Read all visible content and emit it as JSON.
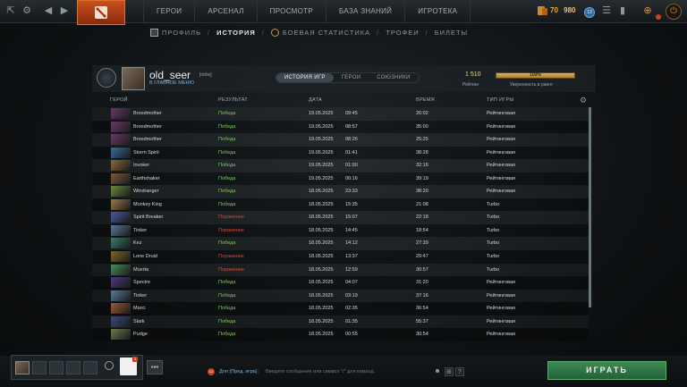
{
  "topbar": {
    "nav": [
      "ГЕРОИ",
      "АРСЕНАЛ",
      "ПРОСМОТР",
      "БАЗА ЗНАНИЙ",
      "ИГРОТЕКА"
    ],
    "gold": "70",
    "shards": "980",
    "level": "13"
  },
  "subnav": {
    "items": [
      "ПРОФИЛЬ",
      "ИСТОРИЯ",
      "БОЕВАЯ СТАТИСТИКА",
      "ТРОФЕИ",
      "БИЛЕТЫ"
    ],
    "active": "ИСТОРИЯ"
  },
  "profile": {
    "username": "old_seer",
    "tag": "[nbbs]",
    "back": "В ГЛАВНОЕ МЕНЮ",
    "tabs": [
      "ИСТОРИЯ ИГР",
      "ГЕРОИ",
      "СОЮЗНИКИ"
    ],
    "rating_value": "1 510",
    "rating_label": "Рейтинг",
    "confidence_value": "100%",
    "confidence_fraction": 1.0,
    "confidence_label": "Уверенность в ранге"
  },
  "table": {
    "headers": [
      "ГЕРОЙ",
      "РЕЗУЛЬТАТ",
      "ДАТА",
      "ВРЕМЯ",
      "ТИП ИГРЫ"
    ],
    "rows": [
      {
        "hero": "Broodmother",
        "result": "Победа",
        "win": true,
        "date": "19.05.2025",
        "time": "09:45",
        "duration": "26:02",
        "type": "Рейтинговая",
        "color": "#6a3a6a"
      },
      {
        "hero": "Broodmother",
        "result": "Победа",
        "win": true,
        "date": "19.05.2025",
        "time": "08:57",
        "duration": "35:00",
        "type": "Рейтинговая",
        "color": "#6a3a6a"
      },
      {
        "hero": "Broodmother",
        "result": "Победа",
        "win": true,
        "date": "19.05.2025",
        "time": "08:26",
        "duration": "25:25",
        "type": "Рейтинговая",
        "color": "#6a3a6a"
      },
      {
        "hero": "Storm Spirit",
        "result": "Победа",
        "win": true,
        "date": "19.05.2025",
        "time": "01:41",
        "duration": "38:28",
        "type": "Рейтинговая",
        "color": "#3a6aa0"
      },
      {
        "hero": "Invoker",
        "result": "Победа",
        "win": true,
        "date": "19.05.2025",
        "time": "01:00",
        "duration": "32:16",
        "type": "Рейтинговая",
        "color": "#8a6a3a"
      },
      {
        "hero": "Earthshaker",
        "result": "Победа",
        "win": true,
        "date": "19.05.2025",
        "time": "00:16",
        "duration": "39:19",
        "type": "Рейтинговая",
        "color": "#7a5a3a"
      },
      {
        "hero": "Windranger",
        "result": "Победа",
        "win": true,
        "date": "18.05.2025",
        "time": "23:33",
        "duration": "38:20",
        "type": "Рейтинговая",
        "color": "#6a8a3a"
      },
      {
        "hero": "Monkey King",
        "result": "Победа",
        "win": true,
        "date": "18.05.2025",
        "time": "15:35",
        "duration": "21:08",
        "type": "Turbo",
        "color": "#9a7a4a"
      },
      {
        "hero": "Spirit Breaker",
        "result": "Поражение",
        "win": false,
        "date": "18.05.2025",
        "time": "15:07",
        "duration": "22:18",
        "type": "Turbo",
        "color": "#4a5aa0"
      },
      {
        "hero": "Tinker",
        "result": "Поражение",
        "win": false,
        "date": "18.05.2025",
        "time": "14:45",
        "duration": "18:54",
        "type": "Turbo",
        "color": "#5a7a9a"
      },
      {
        "hero": "Kez",
        "result": "Победа",
        "win": true,
        "date": "18.05.2025",
        "time": "14:12",
        "duration": "27:39",
        "type": "Turbo",
        "color": "#3a7a6a"
      },
      {
        "hero": "Lone Druid",
        "result": "Поражение",
        "win": false,
        "date": "18.05.2025",
        "time": "13:37",
        "duration": "29:47",
        "type": "Turbo",
        "color": "#7a6a2a"
      },
      {
        "hero": "Muerta",
        "result": "Поражение",
        "win": false,
        "date": "18.05.2025",
        "time": "12:59",
        "duration": "30:57",
        "type": "Turbo",
        "color": "#4a8a5a"
      },
      {
        "hero": "Spectre",
        "result": "Победа",
        "win": true,
        "date": "18.05.2025",
        "time": "04:07",
        "duration": "31:20",
        "type": "Рейтинговая",
        "color": "#4a3a7a"
      },
      {
        "hero": "Tinker",
        "result": "Победа",
        "win": true,
        "date": "18.05.2025",
        "time": "03:19",
        "duration": "37:16",
        "type": "Рейтинговая",
        "color": "#5a7a9a"
      },
      {
        "hero": "Marci",
        "result": "Победа",
        "win": true,
        "date": "18.05.2025",
        "time": "02:35",
        "duration": "36:54",
        "type": "Рейтинговая",
        "color": "#9a5a3a"
      },
      {
        "hero": "Slark",
        "result": "Победа",
        "win": true,
        "date": "18.05.2025",
        "time": "01:35",
        "duration": "55:37",
        "type": "Рейтинговая",
        "color": "#3a4a7a"
      },
      {
        "hero": "Pudge",
        "result": "Победа",
        "win": true,
        "date": "18.05.2025",
        "time": "00:55",
        "duration": "30:54",
        "type": "Рейтинговая",
        "color": "#6a7a4a"
      }
    ]
  },
  "chat": {
    "badge": "13",
    "target": "Для (Пред. игра):",
    "placeholder": "Введите сообщение или символ \"/\" для команд."
  },
  "party": {
    "badge": "3"
  },
  "play_label": "ИГРАТЬ",
  "colors": {
    "win": "#7fc856",
    "loss": "#d44a3a",
    "accent": "#c8501c",
    "play": "#3e8a52"
  }
}
